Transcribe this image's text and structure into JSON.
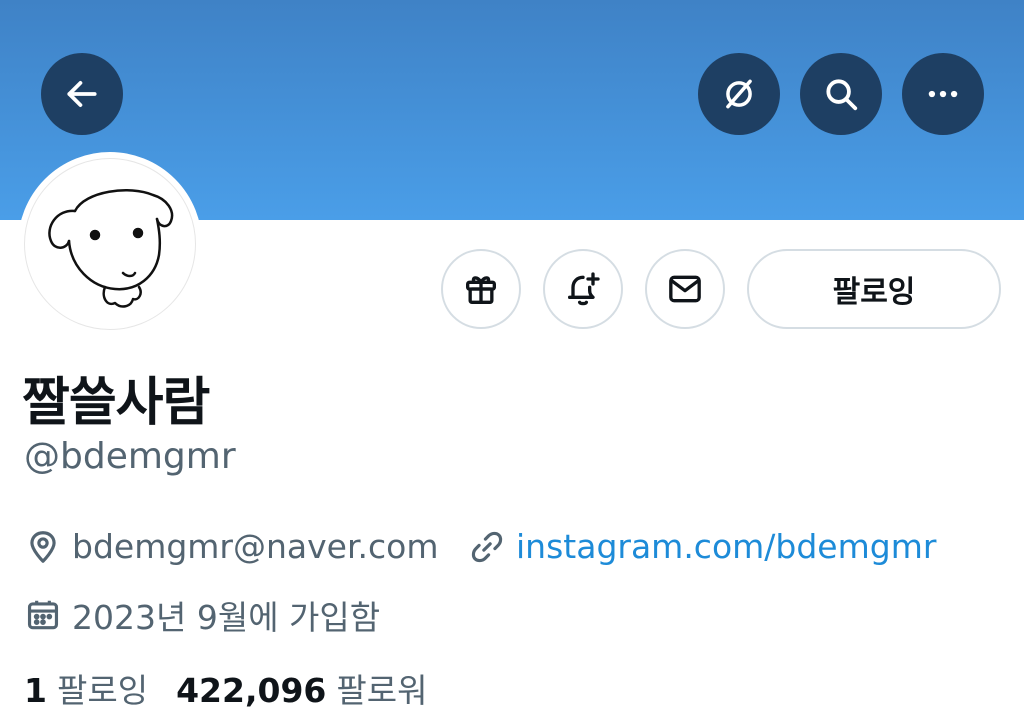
{
  "header": {
    "back_icon": "arrow-left-icon",
    "mute_icon": "slashed-circle-icon",
    "search_icon": "search-icon",
    "more_icon": "more-horizontal-icon",
    "banner_color": "#4a9ee8",
    "button_color": "#1e3f63"
  },
  "profile": {
    "avatar_icon": "puppy-drawing-icon",
    "display_name": "짤쓸사람",
    "handle": "@bdemgmr",
    "location": "bdemgmr@naver.com",
    "website": "instagram.com/bdemgmr",
    "joined": "2023년 9월에 가입함"
  },
  "actions": {
    "gift_icon": "gift-icon",
    "notify_icon": "bell-plus-icon",
    "message_icon": "envelope-icon",
    "follow_label": "팔로잉"
  },
  "stats": {
    "following_count": "1",
    "following_label": "팔로잉",
    "followers_count": "422,096",
    "followers_label": "팔로워"
  },
  "colors": {
    "link": "#1d8bd8",
    "secondary_text": "#536471",
    "primary_text": "#0f1419"
  }
}
